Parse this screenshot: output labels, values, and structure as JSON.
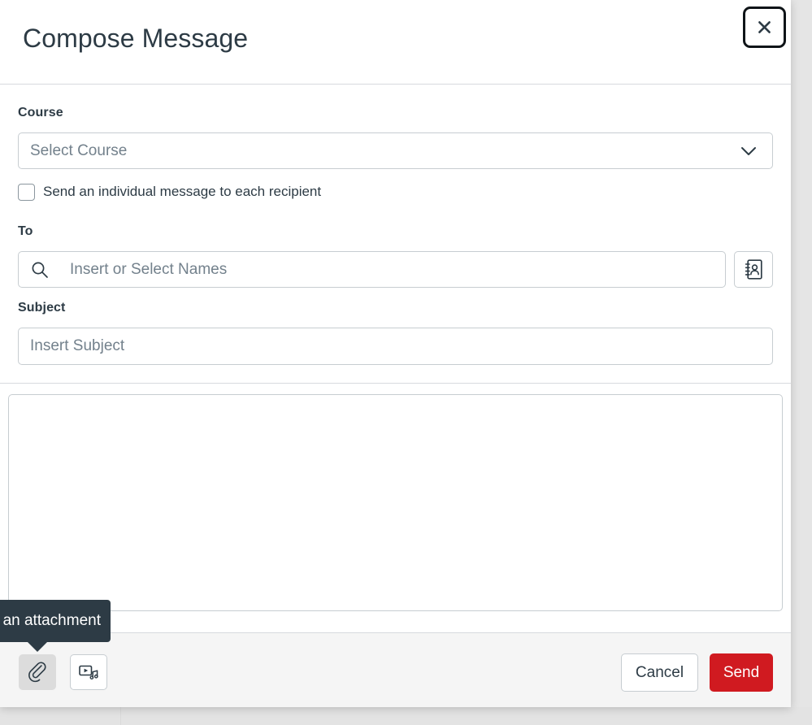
{
  "colors": {
    "brand_red": "#d01a20",
    "text_dark": "#2d3b45",
    "placeholder": "#73818c",
    "border": "#c7cdd1",
    "footer_bg": "#f5f5f5",
    "tooltip_bg": "#2d3b45"
  },
  "header": {
    "title": "Compose Message",
    "close_label": "Close",
    "close_icon": "close-icon"
  },
  "form": {
    "course": {
      "label": "Course",
      "placeholder": "Select Course",
      "value": "",
      "chevron_icon": "chevron-down-icon"
    },
    "individual": {
      "label": "Send an individual message to each recipient",
      "checked": false
    },
    "to": {
      "label": "To",
      "placeholder": "Insert or Select Names",
      "value": "",
      "search_icon": "search-icon",
      "address_book_icon": "address-book-icon",
      "address_book_label": "Address Book"
    },
    "subject": {
      "label": "Subject",
      "placeholder": "Insert Subject",
      "value": ""
    },
    "message_body": {
      "placeholder": "",
      "value": ""
    }
  },
  "footer": {
    "attach_icon": "paperclip-icon",
    "attach_label": "Add an attachment",
    "media_icon": "record-media-icon",
    "media_label": "Record an audio or video comment",
    "cancel_label": "Cancel",
    "send_label": "Send"
  },
  "tooltip": {
    "text": "d an attachment"
  }
}
